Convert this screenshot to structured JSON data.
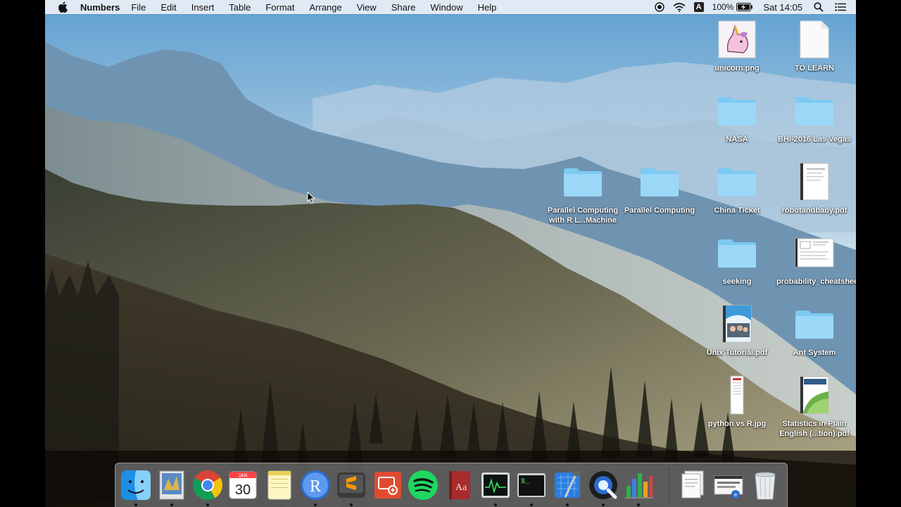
{
  "menubar": {
    "app_name": "Numbers",
    "items": [
      "File",
      "Edit",
      "Insert",
      "Table",
      "Format",
      "Arrange",
      "View",
      "Share",
      "Window",
      "Help"
    ],
    "status": {
      "battery": "100%",
      "clock": "Sat 14:05",
      "input_source": "A"
    }
  },
  "desktop_icons": [
    {
      "name": "unicorn.png",
      "kind": "image"
    },
    {
      "name": "TO LEARN",
      "kind": "document"
    },
    {
      "name": "NASA",
      "kind": "folder"
    },
    {
      "name": "BHI-2016 Las Vegas",
      "kind": "folder"
    },
    {
      "name": "Parallel Computing with R L...Machine",
      "kind": "folder"
    },
    {
      "name": "Parallel Computing",
      "kind": "folder"
    },
    {
      "name": "China Ticket",
      "kind": "folder"
    },
    {
      "name": "robotandbaby.pdf",
      "kind": "pdf"
    },
    {
      "name": "seeking",
      "kind": "folder"
    },
    {
      "name": "probability_cheatsheet.pdf",
      "kind": "pdf"
    },
    {
      "name": "Unix Tutorial.pdf",
      "kind": "pdf"
    },
    {
      "name": "Ant System",
      "kind": "folder"
    },
    {
      "name": "python vs R.jpg",
      "kind": "image"
    },
    {
      "name": "Statistics in Plain English (...tion).pdf",
      "kind": "pdf"
    }
  ],
  "dock": {
    "apps": [
      {
        "name": "Finder",
        "icon": "finder-icon",
        "running": true
      },
      {
        "name": "Preview",
        "icon": "preview-icon",
        "running": true
      },
      {
        "name": "Google Chrome",
        "icon": "chrome-icon",
        "running": true
      },
      {
        "name": "Calendar",
        "icon": "calendar-icon",
        "running": false,
        "month": "JAN",
        "day": "30"
      },
      {
        "name": "Notes",
        "icon": "notes-icon",
        "running": false
      },
      {
        "name": "R",
        "icon": "r-icon",
        "running": true
      },
      {
        "name": "Sublime Text",
        "icon": "sublime-icon",
        "running": true
      },
      {
        "name": "Remote Desktop",
        "icon": "remote-desktop-icon",
        "running": false
      },
      {
        "name": "Spotify",
        "icon": "spotify-icon",
        "running": false
      },
      {
        "name": "Dictionary",
        "icon": "dictionary-icon",
        "running": false,
        "glyph": "Aa"
      },
      {
        "name": "Activity Monitor",
        "icon": "activity-monitor-icon",
        "running": true
      },
      {
        "name": "Terminal",
        "icon": "terminal-icon",
        "running": true,
        "glyph": "$_"
      },
      {
        "name": "Xcode",
        "icon": "xcode-icon",
        "running": true
      },
      {
        "name": "QuickTime Player",
        "icon": "quicktime-icon",
        "running": true
      },
      {
        "name": "Numbers",
        "icon": "numbers-icon",
        "running": true
      }
    ],
    "others": [
      {
        "name": "Documents stack",
        "icon": "documents-stack-icon"
      },
      {
        "name": "Screenshot stack",
        "icon": "screenshot-stack-icon"
      },
      {
        "name": "Trash",
        "icon": "trash-icon"
      }
    ]
  }
}
